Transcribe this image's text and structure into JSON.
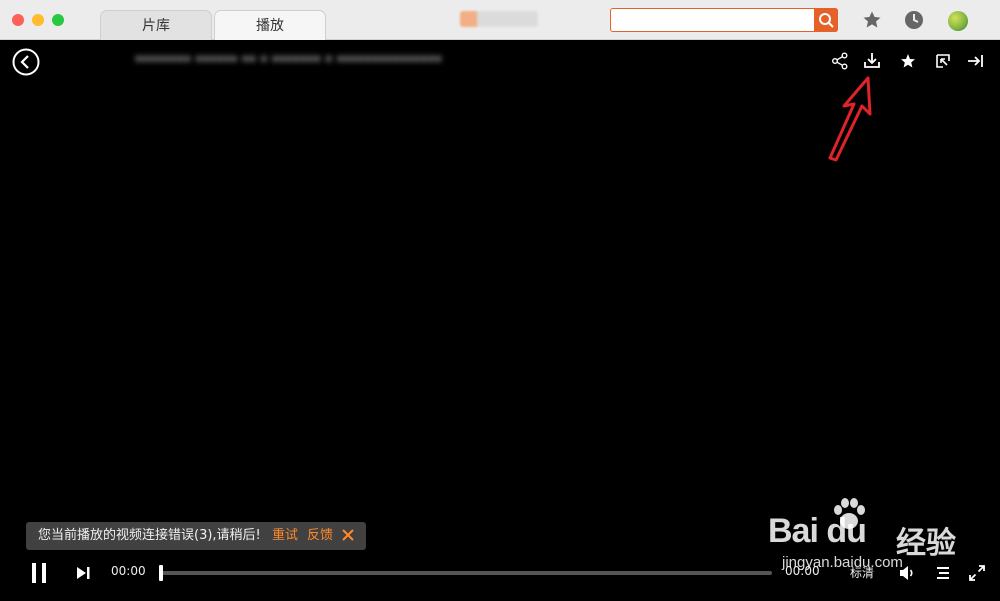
{
  "window": {
    "tabs": [
      {
        "label": "片库"
      },
      {
        "label": "播放"
      }
    ],
    "search": {
      "placeholder": ""
    },
    "icons": {
      "search": "search-icon",
      "favorites": "star-icon",
      "history": "clock-icon",
      "avatar": "user-avatar"
    }
  },
  "player": {
    "title": "******** ****** ** * ******* * ***************",
    "top_icons": [
      "share-icon",
      "download-icon",
      "star-icon",
      "pip-icon",
      "pin-icon"
    ],
    "error": {
      "message": "您当前播放的视频连接错误(3),请稍后!",
      "retry": "重试",
      "feedback": "反馈"
    },
    "controls": {
      "current_time": "00:00",
      "total_time": "00:00",
      "progress": 0,
      "quality": "标清"
    }
  },
  "watermark": {
    "brand": "Bai  du",
    "suffix": "经验",
    "url": "jingyan.baidu.com"
  },
  "colors": {
    "accent": "#e6602a",
    "error_link": "#ff8a2b",
    "annotation": "#e0222a"
  }
}
